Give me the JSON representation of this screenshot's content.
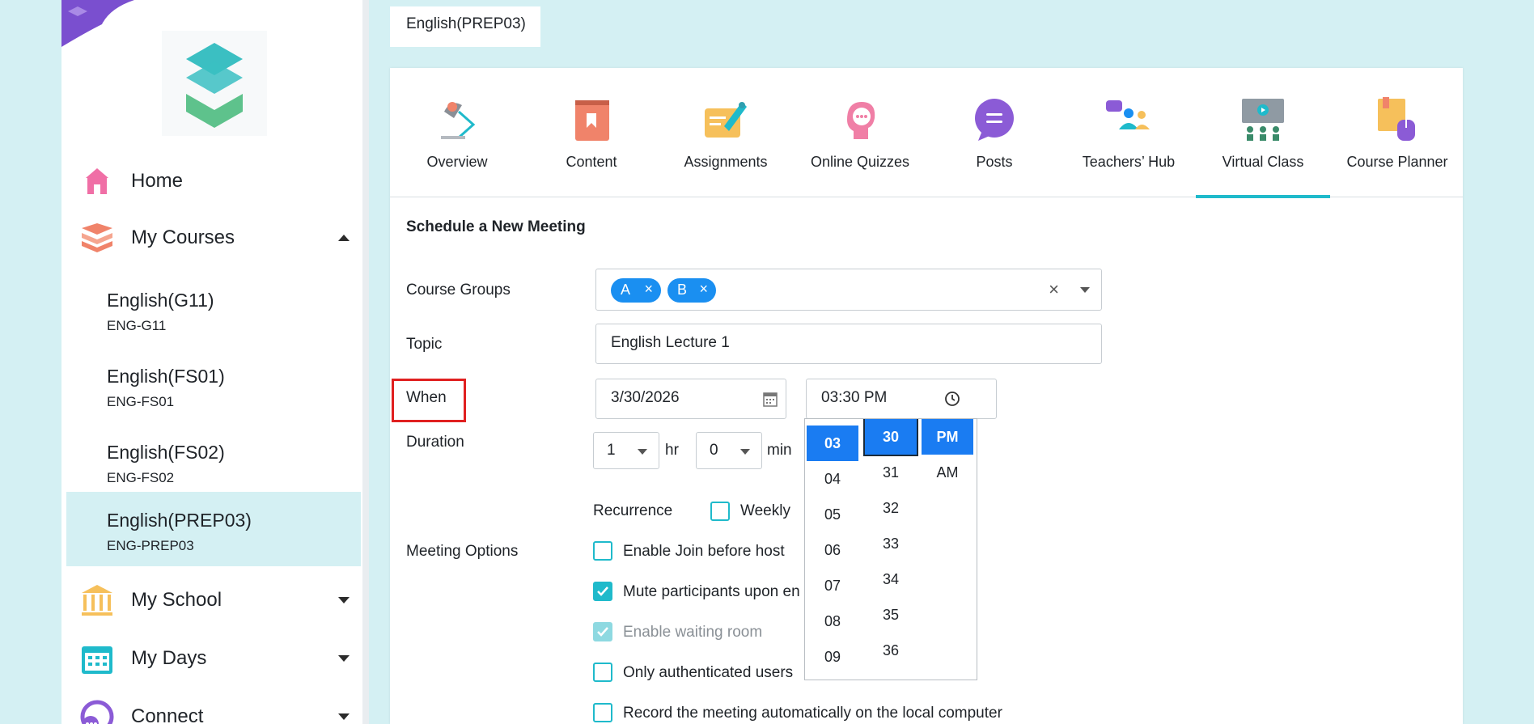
{
  "sidebar": {
    "nav": [
      {
        "label": "Home",
        "icon": "home-icon",
        "color": "#f06fa6"
      },
      {
        "label": "My Courses",
        "icon": "books-icon",
        "color": "#f0836a"
      },
      {
        "label": "My School",
        "icon": "school-icon",
        "color": "#f6c05b"
      },
      {
        "label": "My Days",
        "icon": "calendar-icon",
        "color": "#1fbacb"
      },
      {
        "label": "Connect",
        "icon": "connect-icon",
        "color": "#8b5bd6"
      }
    ],
    "courses": [
      {
        "title": "English(G11)",
        "code": "ENG-G11"
      },
      {
        "title": "English(FS01)",
        "code": "ENG-FS01"
      },
      {
        "title": "English(FS02)",
        "code": "ENG-FS02"
      },
      {
        "title": "English(PREP03)",
        "code": "ENG-PREP03"
      }
    ]
  },
  "breadcrumb": "English(PREP03)",
  "tabs": [
    {
      "label": "Overview",
      "icon": "lamp-icon"
    },
    {
      "label": "Content",
      "icon": "book-icon"
    },
    {
      "label": "Assignments",
      "icon": "pen-icon"
    },
    {
      "label": "Online Quizzes",
      "icon": "head-icon"
    },
    {
      "label": "Posts",
      "icon": "chat-icon"
    },
    {
      "label": "Teachers’ Hub",
      "icon": "teachers-icon"
    },
    {
      "label": "Virtual Class",
      "icon": "virtual-class-icon"
    },
    {
      "label": "Course Planner",
      "icon": "planner-icon"
    }
  ],
  "active_tab": "Virtual Class",
  "form": {
    "title": "Schedule a New Meeting",
    "course_groups_label": "Course Groups",
    "chips": [
      "A",
      "B"
    ],
    "chip_remove": "×",
    "clear": "×",
    "topic_label": "Topic",
    "topic_value": "English Lecture 1",
    "when_label": "When",
    "date_value": "3/30/2026",
    "time_value": "03:30 PM",
    "duration_label": "Duration",
    "hours_value": "1",
    "hours_unit": "hr",
    "minutes_value": "0",
    "minutes_unit": "min",
    "recurrence_label": "Recurrence",
    "weekly_label": "Weekly",
    "meeting_options_label": "Meeting Options",
    "options": [
      {
        "label": "Enable Join before host",
        "checked": false,
        "disabled": false
      },
      {
        "label": "Mute participants upon en",
        "checked": true,
        "disabled": false
      },
      {
        "label": "Enable waiting room",
        "checked": true,
        "disabled": true
      },
      {
        "label": "Only authenticated users",
        "checked": false,
        "disabled": false
      },
      {
        "label": "Record the meeting automatically on the local computer",
        "checked": false,
        "disabled": false
      }
    ]
  },
  "time_picker": {
    "hours": [
      "03",
      "04",
      "05",
      "06",
      "07",
      "08",
      "09"
    ],
    "minutes": [
      "30",
      "31",
      "32",
      "33",
      "34",
      "35",
      "36"
    ],
    "periods": [
      "PM",
      "AM"
    ],
    "selected_hour": "03",
    "selected_minute": "30",
    "selected_period": "PM"
  },
  "colors": {
    "accent": "#1fbacb",
    "chip": "#1a8ff1",
    "selected": "#1a7cf2",
    "highlight_box": "#e02020"
  }
}
